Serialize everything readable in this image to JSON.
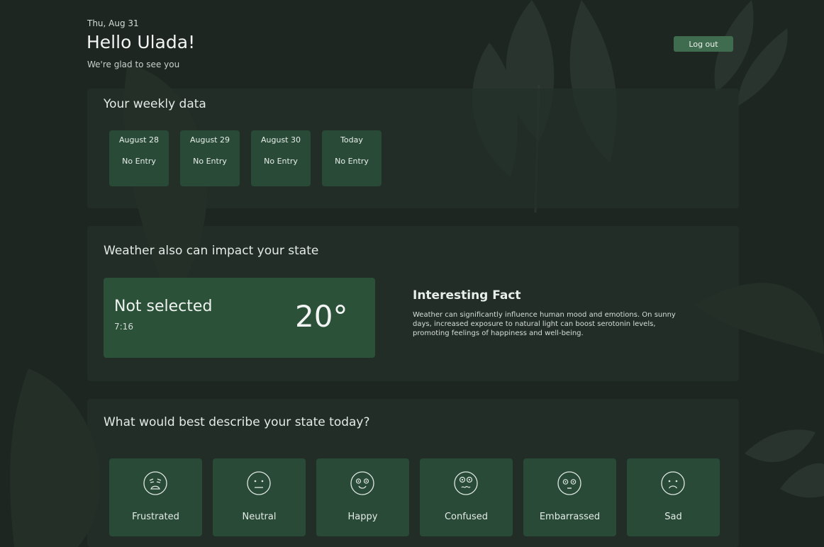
{
  "header": {
    "date": "Thu, Aug 31",
    "greeting": "Hello Ulada!",
    "subtitle": "We're glad to see you",
    "logout_label": "Log out"
  },
  "weekly": {
    "title": "Your weekly data",
    "days": [
      {
        "label": "August 28",
        "value": "No Entry"
      },
      {
        "label": "August 29",
        "value": "No Entry"
      },
      {
        "label": "August 30",
        "value": "No Entry"
      },
      {
        "label": "Today",
        "value": "No Entry"
      }
    ]
  },
  "weather": {
    "title": "Weather also can impact your state",
    "location": "Not selected",
    "time": "7:16",
    "temperature": "20°",
    "fact_title": "Interesting Fact",
    "fact_text": "Weather can significantly influence human mood and emotions. On sunny days, increased exposure to natural light can boost serotonin levels, promoting feelings of happiness and well-being."
  },
  "mood": {
    "title": "What would best describe your state today?",
    "options": [
      {
        "label": "Frustrated",
        "icon": "frustrated-face-icon"
      },
      {
        "label": "Neutral",
        "icon": "neutral-face-icon"
      },
      {
        "label": "Happy",
        "icon": "happy-face-icon"
      },
      {
        "label": "Confused",
        "icon": "confused-face-icon"
      },
      {
        "label": "Embarrassed",
        "icon": "embarrassed-face-icon"
      },
      {
        "label": "Sad",
        "icon": "sad-face-icon"
      }
    ]
  },
  "colors": {
    "background": "#1d2621",
    "card": "#243029",
    "tile": "#284a37",
    "weather_box": "#2b5139",
    "button": "#3f6b4e"
  }
}
